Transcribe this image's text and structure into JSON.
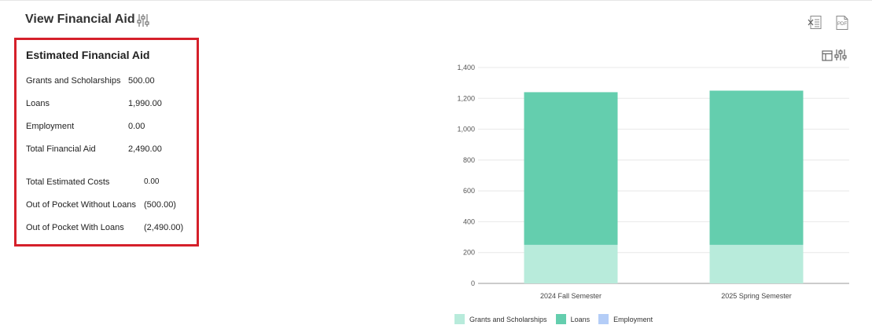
{
  "header": {
    "title": "View Financial Aid",
    "filter_icon": "sliders-icon",
    "export_excel_icon": "excel-export-icon",
    "export_pdf_icon": "pdf-export-icon",
    "pdf_glyph": "PDF"
  },
  "aid_summary": {
    "title": "Estimated Financial Aid",
    "rows": [
      {
        "label": "Grants and Scholarships",
        "value": "500.00"
      },
      {
        "label": "Loans",
        "value": "1,990.00"
      },
      {
        "label": "Employment",
        "value": "0.00"
      },
      {
        "label": "Total Financial Aid",
        "value": "2,490.00"
      },
      {
        "label": "Total Estimated Costs",
        "value": "0.00"
      },
      {
        "label": "Out of Pocket Without Loans",
        "value": "(500.00)"
      },
      {
        "label": "Out of Pocket With Loans",
        "value": "(2,490.00)"
      }
    ]
  },
  "colors": {
    "highlight_border": "#d5202a",
    "grants": "#b8ebdb",
    "loans": "#64ceae",
    "employment": "#b4cdf7"
  },
  "chart_data": {
    "type": "bar",
    "stacked": true,
    "categories": [
      "2024 Fall Semester",
      "2025 Spring Semester"
    ],
    "series": [
      {
        "name": "Grants and Scholarships",
        "values": [
          250,
          250
        ]
      },
      {
        "name": "Loans",
        "values": [
          990,
          1000
        ]
      },
      {
        "name": "Employment",
        "values": [
          0,
          0
        ]
      }
    ],
    "ylim": [
      0,
      1400
    ],
    "yticks": [
      "0",
      "200",
      "400",
      "600",
      "800",
      "1,000",
      "1,200",
      "1,400"
    ],
    "grid": true,
    "legend": "bottom",
    "xlabel": "",
    "ylabel": ""
  },
  "chart_toolbar": {
    "table_icon": "table-view-icon",
    "filter_icon": "sliders-icon"
  }
}
